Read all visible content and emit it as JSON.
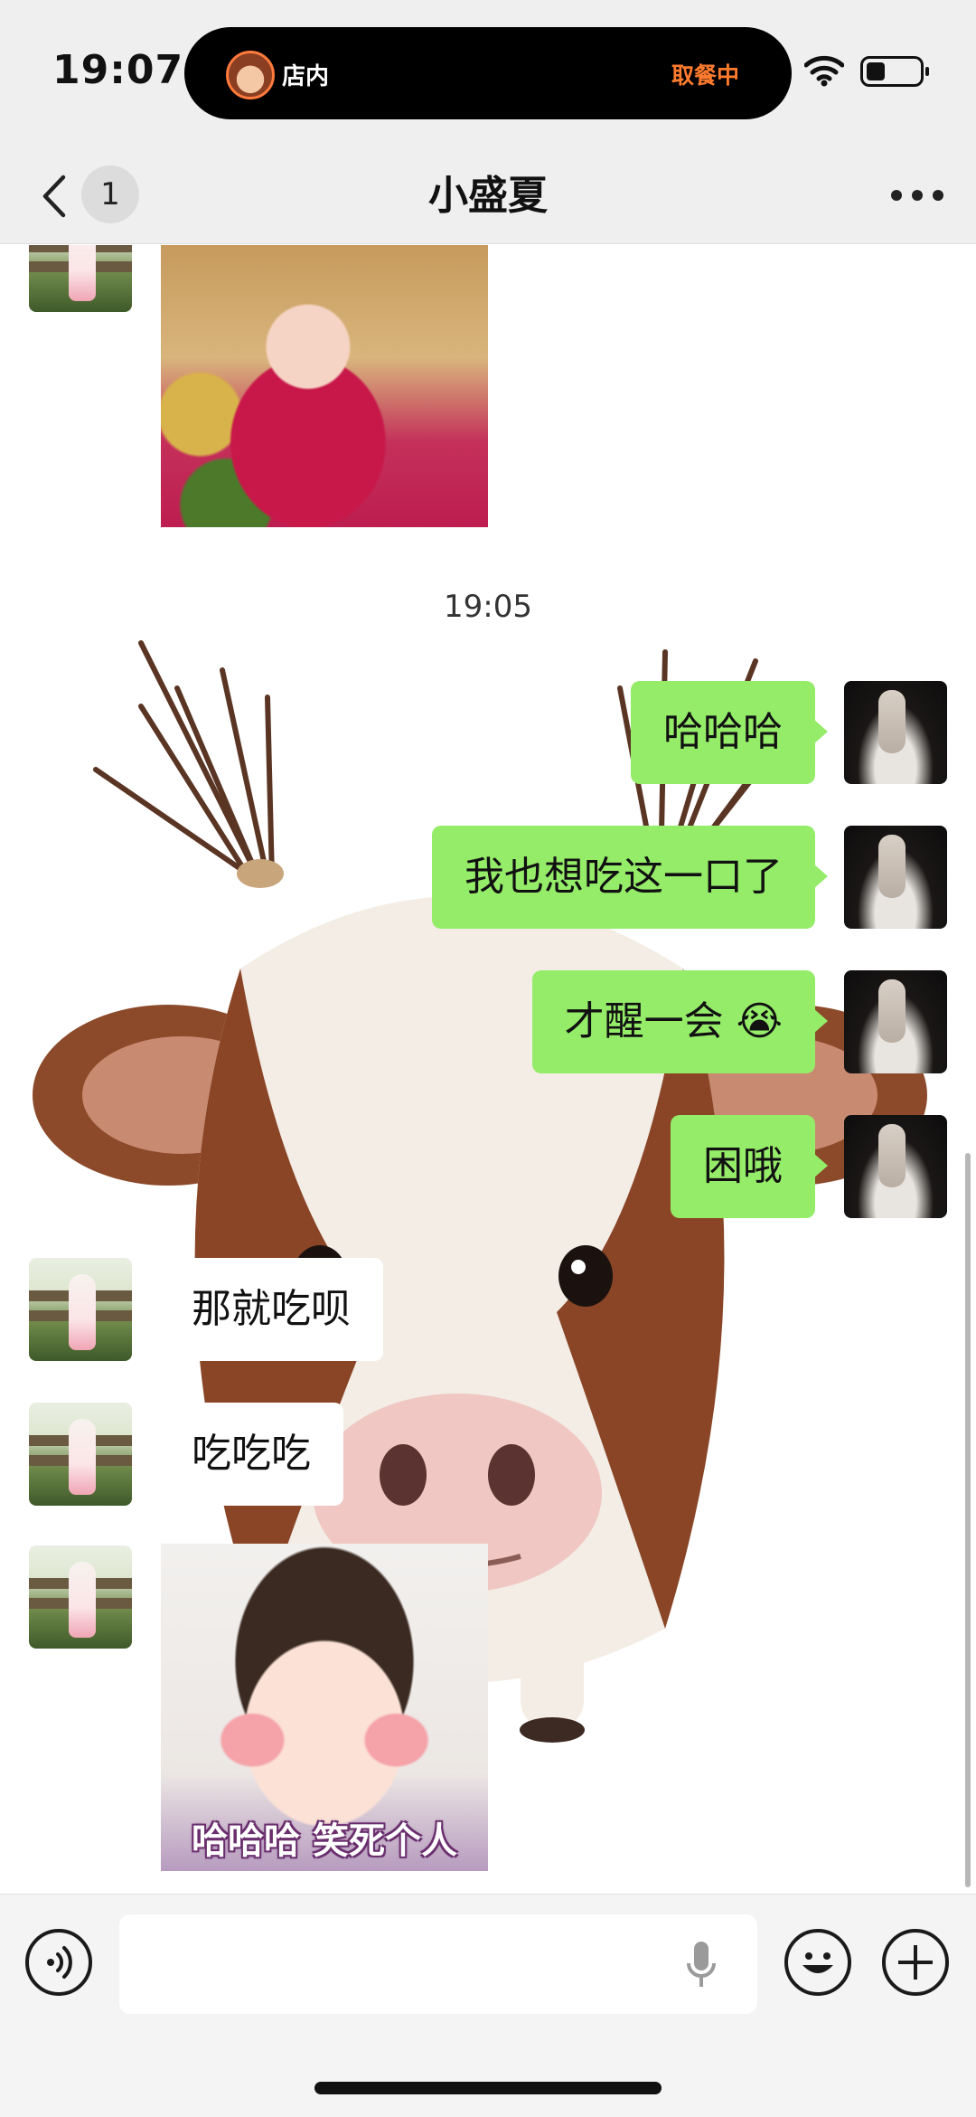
{
  "status_bar": {
    "time": "19:07",
    "island_label": "店内",
    "island_status": "取餐中"
  },
  "nav": {
    "unread_count": "1",
    "title": "小盛夏"
  },
  "messages": {
    "timestamp": "19:05",
    "right": [
      "哈哈哈",
      "我也想吃这一口了",
      "才醒一会 😭",
      "困哦"
    ],
    "left": [
      "那就吃呗",
      "吃吃吃"
    ],
    "sticker_caption": "哈哈哈 笑死个人"
  },
  "input": {
    "value": "",
    "placeholder": ""
  },
  "colors": {
    "bubble_right": "#95ec69",
    "bubble_left": "#ffffff",
    "background": "#ffffff",
    "bar": "#efefef",
    "island_status": "#ff7b2e"
  }
}
